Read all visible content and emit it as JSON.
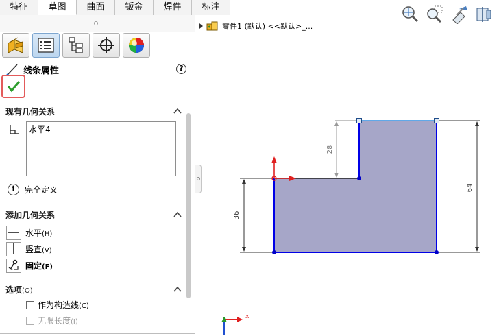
{
  "command_tabs": [
    {
      "label": "特征",
      "active": false
    },
    {
      "label": "草图",
      "active": true
    },
    {
      "label": "曲面",
      "active": false
    },
    {
      "label": "钣金",
      "active": false
    },
    {
      "label": "焊件",
      "active": false
    },
    {
      "label": "标注",
      "active": false
    }
  ],
  "manager_tabs": [
    "feature-manager-icon",
    "property-manager-icon",
    "configuration-manager-icon",
    "dimxpert-manager-icon",
    "display-manager-icon"
  ],
  "property_manager": {
    "title": "线条属性",
    "help_symbol": "?",
    "existing_relations": {
      "header": "现有几何关系",
      "items": [
        "水平4"
      ],
      "status": "完全定义"
    },
    "add_relations": {
      "header": "添加几何关系",
      "items": [
        {
          "label": "水平",
          "shortcut": "(H)",
          "icon": "horizontal-relation-icon",
          "bold": false
        },
        {
          "label": "竖直",
          "shortcut": "(V)",
          "icon": "vertical-relation-icon",
          "bold": false
        },
        {
          "label": "固定",
          "shortcut": "(F)",
          "icon": "fix-relation-icon",
          "bold": true
        }
      ]
    },
    "options": {
      "header": "选项",
      "header_shortcut": "(O)",
      "items": [
        {
          "label": "作为构造线",
          "shortcut": "(C)",
          "checked": false,
          "enabled": true
        },
        {
          "label": "无限长度",
          "shortcut": "(I)",
          "checked": false,
          "enabled": false
        }
      ]
    }
  },
  "feature_tree": {
    "label": "零件1 (默认) <<默认>_..."
  },
  "sketch": {
    "dimensions": {
      "left_height": "36",
      "step_height": "28",
      "right_height": "64"
    },
    "fill_color": "#a6a6c8",
    "line_color": "#0000e6",
    "selected_line_color": "#60a8e8"
  },
  "triad": {
    "x_label": "x"
  },
  "colors": {
    "ok_border": "#e35b5b",
    "ok_check": "#2e9e2e"
  }
}
